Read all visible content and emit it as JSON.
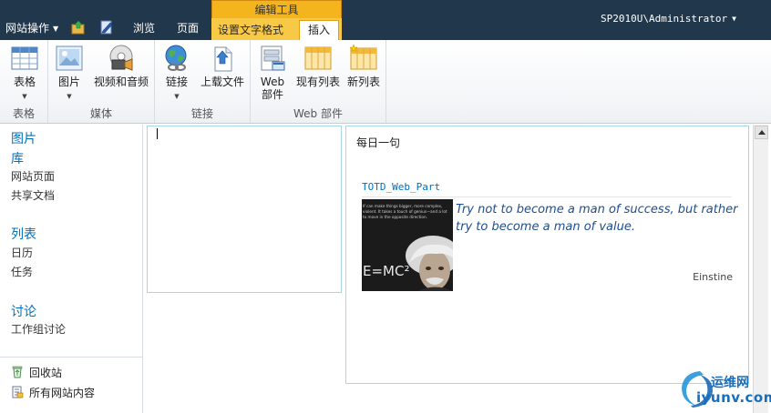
{
  "topbar": {
    "site_actions": "网站操作",
    "tabs": {
      "browse": "浏览",
      "page": "页面"
    },
    "tool_group": "编辑工具",
    "tool_tabs": {
      "format_text": "设置文字格式",
      "insert": "插入"
    },
    "user": "SP2010U\\Administrator"
  },
  "ribbon": {
    "groups": {
      "tables": "表格",
      "media": "媒体",
      "links": "链接",
      "web_parts": "Web 部件"
    },
    "buttons": {
      "table": "表格",
      "picture": "图片",
      "video_audio": "视频和音频",
      "link": "链接",
      "upload_file": "上载文件",
      "web_part_line1": "Web",
      "web_part_line2": "部件",
      "existing_list": "现有列表",
      "new_list": "新列表"
    }
  },
  "quicklaunch": {
    "pictures": "图片",
    "libraries": "库",
    "site_pages": "网站页面",
    "shared_docs": "共享文档",
    "lists": "列表",
    "calendar": "日历",
    "tasks": "任务",
    "discussions": "讨论",
    "team_discussion": "工作组讨论",
    "recycle_bin": "回收站",
    "all_site_content": "所有网站内容"
  },
  "webpart": {
    "title": "每日一句",
    "totd_title": "TOTD_Web_Part",
    "quote": "Try not to become a man of success, but rather try to become a man of value.",
    "author": "Einstine",
    "photo_text_lines": [
      "If can make things bigger, more complex,",
      "violent. It takes a touch of genius—and a lot",
      "to move in the opposite direction."
    ],
    "photo_formula": "E=MC²"
  },
  "watermark": {
    "cn": "运维网",
    "domain": "iyunv.com"
  },
  "colors": {
    "topbar": "#21374c",
    "tool_group": "#f3b41d",
    "link": "#0072bc"
  }
}
